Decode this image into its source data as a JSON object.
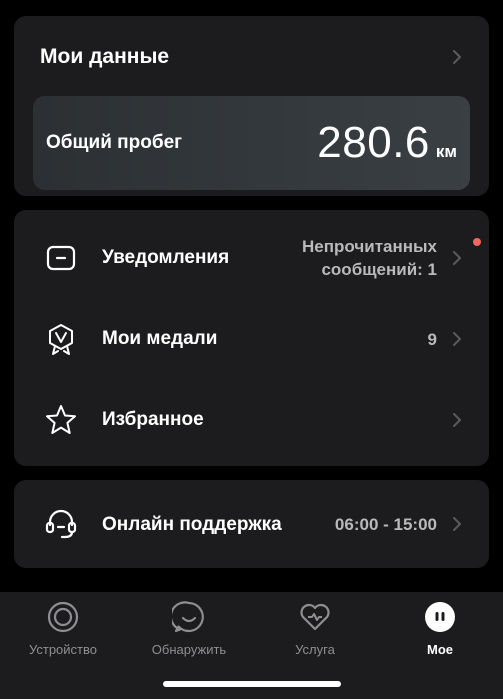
{
  "my_data": {
    "title": "Мои данные",
    "mileage_label": "Общий пробег",
    "mileage_value": "280.6",
    "mileage_unit": "км"
  },
  "menu": {
    "notifications": {
      "label": "Уведомления",
      "value": "Непрочитанных сообщений: 1",
      "icon": "message-icon"
    },
    "medals": {
      "label": "Мои медали",
      "value": "9",
      "icon": "medal-icon"
    },
    "favorites": {
      "label": "Избранное",
      "icon": "star-icon"
    }
  },
  "support": {
    "label": "Онлайн поддержка",
    "hours": "06:00 - 15:00",
    "icon": "headset-icon"
  },
  "tabs": [
    {
      "label": "Устройство",
      "icon": "device-icon"
    },
    {
      "label": "Обнаружить",
      "icon": "discover-icon"
    },
    {
      "label": "Услуга",
      "icon": "heart-icon"
    },
    {
      "label": "Мое",
      "icon": "profile-icon",
      "active": true
    }
  ],
  "colors": {
    "background": "#000000",
    "card": "#1c1c1e",
    "badge": "#f2685a",
    "secondary_text": "#b9b9bc",
    "tab_inactive": "#8e8e93"
  }
}
